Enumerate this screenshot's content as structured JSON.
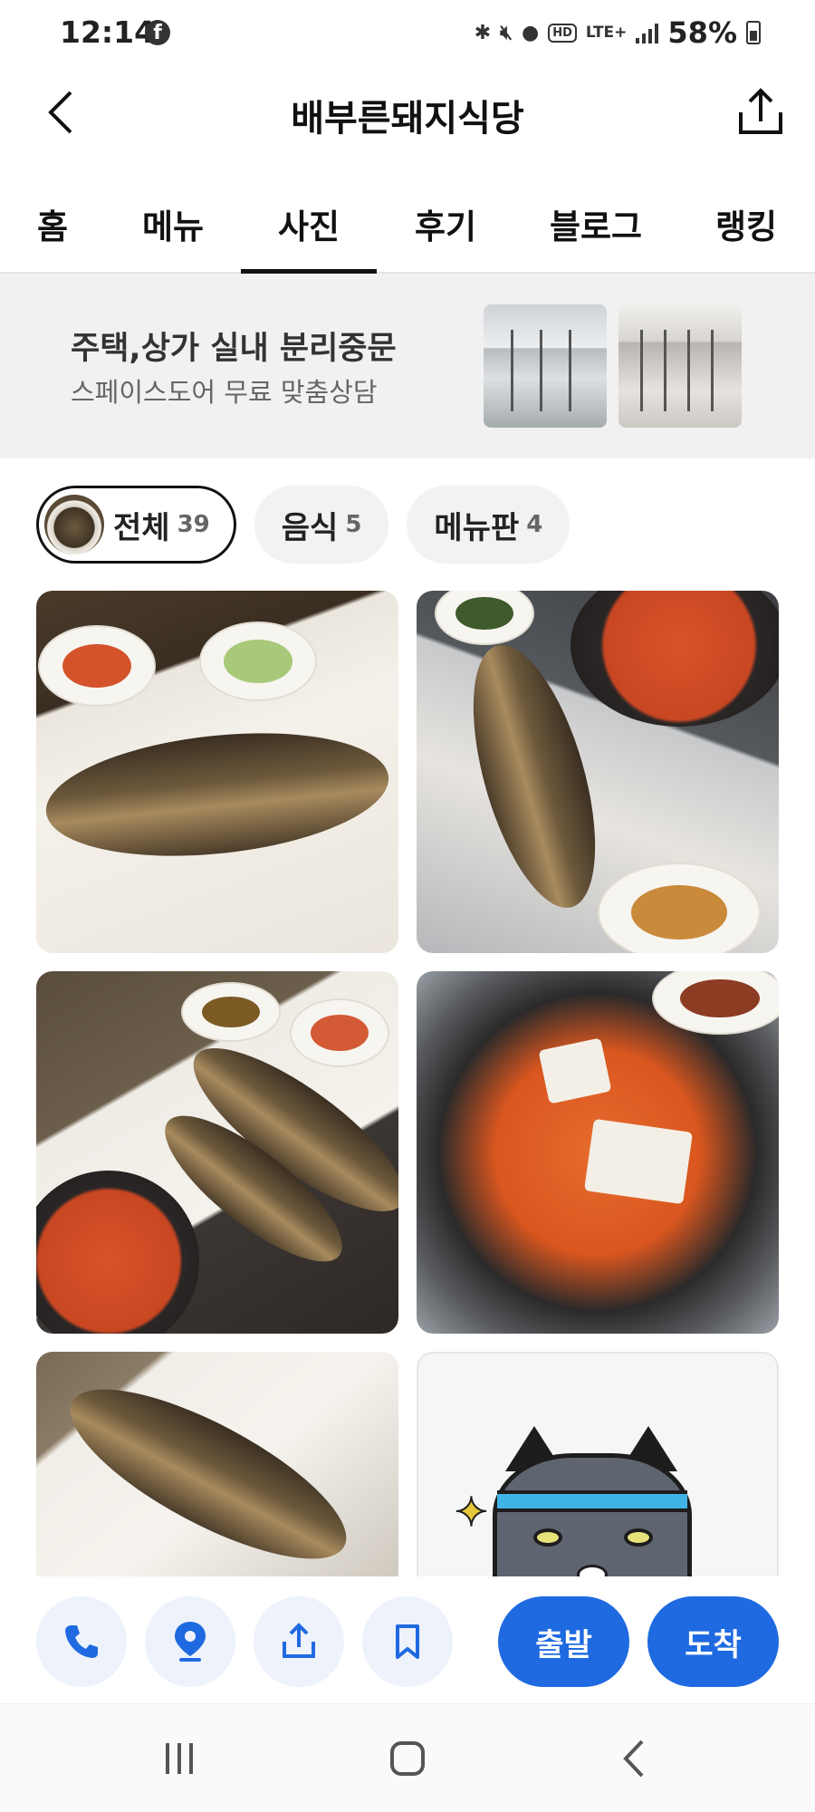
{
  "status_bar": {
    "time": "12:14",
    "network": "LTE+",
    "hd": "HD",
    "battery_percent": "58%"
  },
  "header": {
    "title": "배부른돼지식당"
  },
  "tabs": [
    {
      "label": "홈",
      "active": false
    },
    {
      "label": "메뉴",
      "active": false
    },
    {
      "label": "사진",
      "active": true
    },
    {
      "label": "후기",
      "active": false
    },
    {
      "label": "블로그",
      "active": false
    },
    {
      "label": "랭킹",
      "active": false
    }
  ],
  "ad": {
    "title": "주택,상가 실내 분리중문",
    "subtitle": "스페이스도어 무료 맞춤상담"
  },
  "filters": [
    {
      "label": "전체",
      "count": "39",
      "active": true
    },
    {
      "label": "음식",
      "count": "5",
      "active": false
    },
    {
      "label": "메뉴판",
      "count": "4",
      "active": false
    }
  ],
  "actions": {
    "depart_label": "출발",
    "arrive_label": "도착"
  },
  "colors": {
    "accent": "#1f6ae0",
    "chip_bg": "#f2f2f2",
    "icon_button_bg": "#edf2fb"
  }
}
